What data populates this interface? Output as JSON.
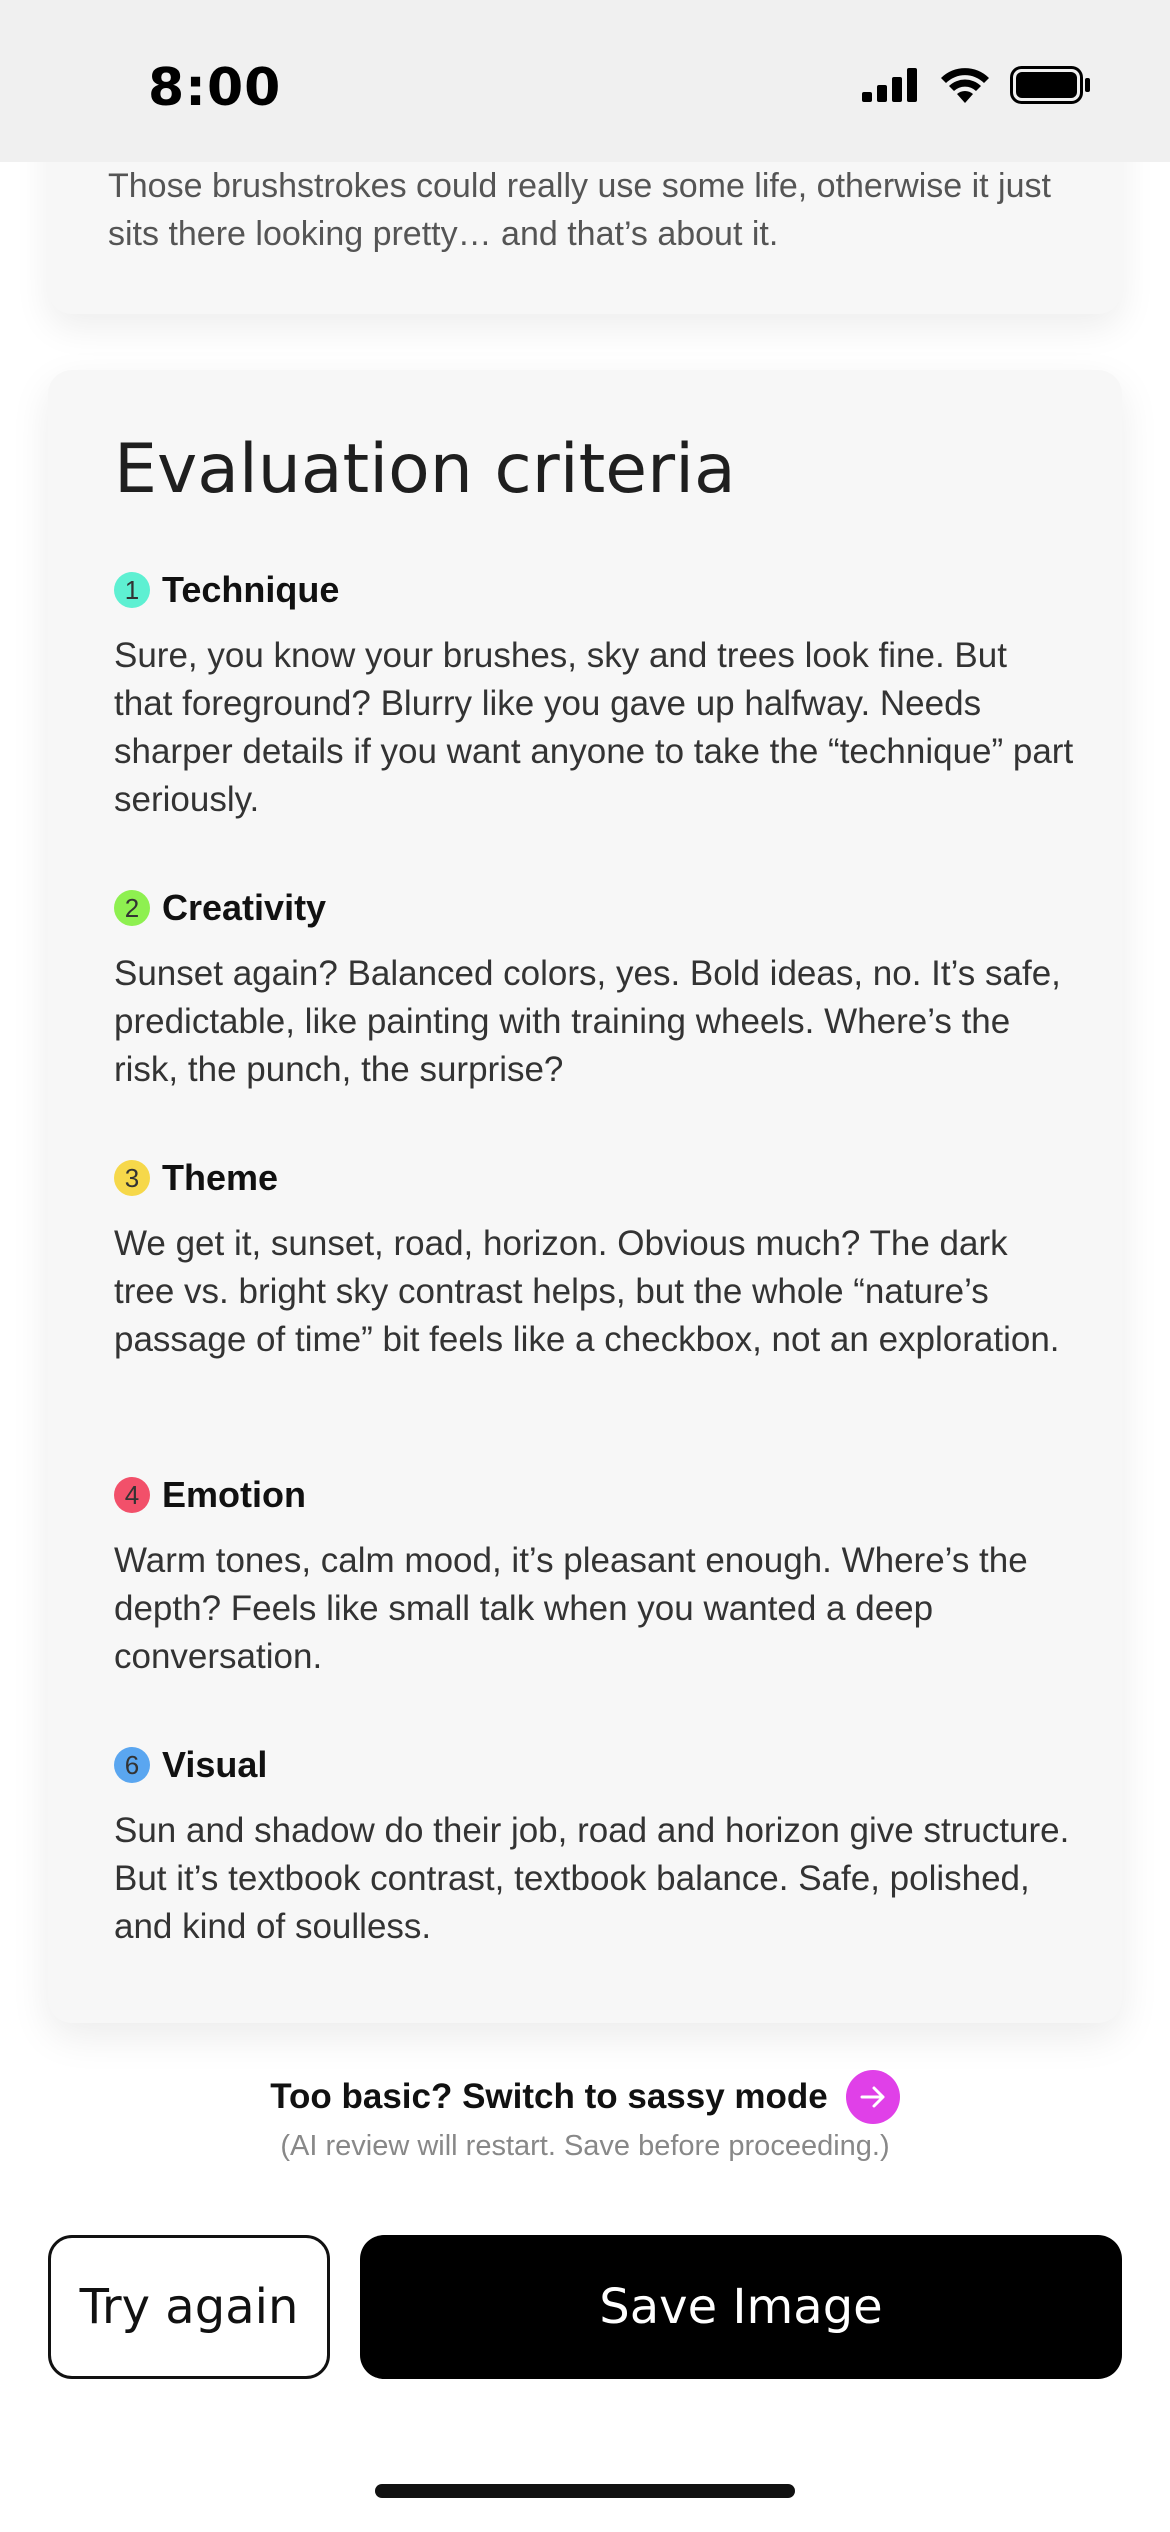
{
  "status_bar": {
    "time": "8:00",
    "icons": [
      "cellular-signal-icon",
      "wifi-icon",
      "battery-icon"
    ]
  },
  "summary_card": {
    "text": "Those brushstrokes could really use some life, otherwise it just sits there looking pretty… and that’s about it."
  },
  "evaluation": {
    "title": "Evaluation criteria",
    "criteria": [
      {
        "number": "1",
        "name": "Technique",
        "color": "#5ef0d2",
        "text": "Sure, you know your brushes, sky and trees look fine. But that foreground? Blurry like you gave up halfway. Needs sharper details if you want anyone to take the “technique” part seriously."
      },
      {
        "number": "2",
        "name": "Creativity",
        "color": "#8ef050",
        "text": "Sunset again? Balanced colors, yes. Bold ideas, no. It’s safe, predictable, like painting with training wheels. Where’s the risk, the punch, the surprise?"
      },
      {
        "number": "3",
        "name": "Theme",
        "color": "#f6d84a",
        "text": "We get it, sunset, road, horizon. Obvious much? The dark tree vs. bright sky contrast helps, but the whole “nature’s passage of time” bit feels like a checkbox, not an exploration."
      },
      {
        "number": "4",
        "name": "Emotion",
        "color": "#f2506a",
        "text": "Warm tones, calm mood, it’s pleasant enough. Where’s the depth? Feels like small talk when you wanted a deep conversation."
      },
      {
        "number": "6",
        "name": "Visual",
        "color": "#5aa6f0",
        "text": "Sun and shadow do their job, road and horizon give structure. But it’s textbook contrast, textbook balance. Safe, polished, and kind of soulless."
      }
    ]
  },
  "sassy": {
    "label": "Too basic? Switch to sassy mode",
    "note": "(AI review will restart. Save before proceeding.)",
    "accent": "#e040e8"
  },
  "actions": {
    "try_again": "Try again",
    "save_image": "Save Image"
  }
}
